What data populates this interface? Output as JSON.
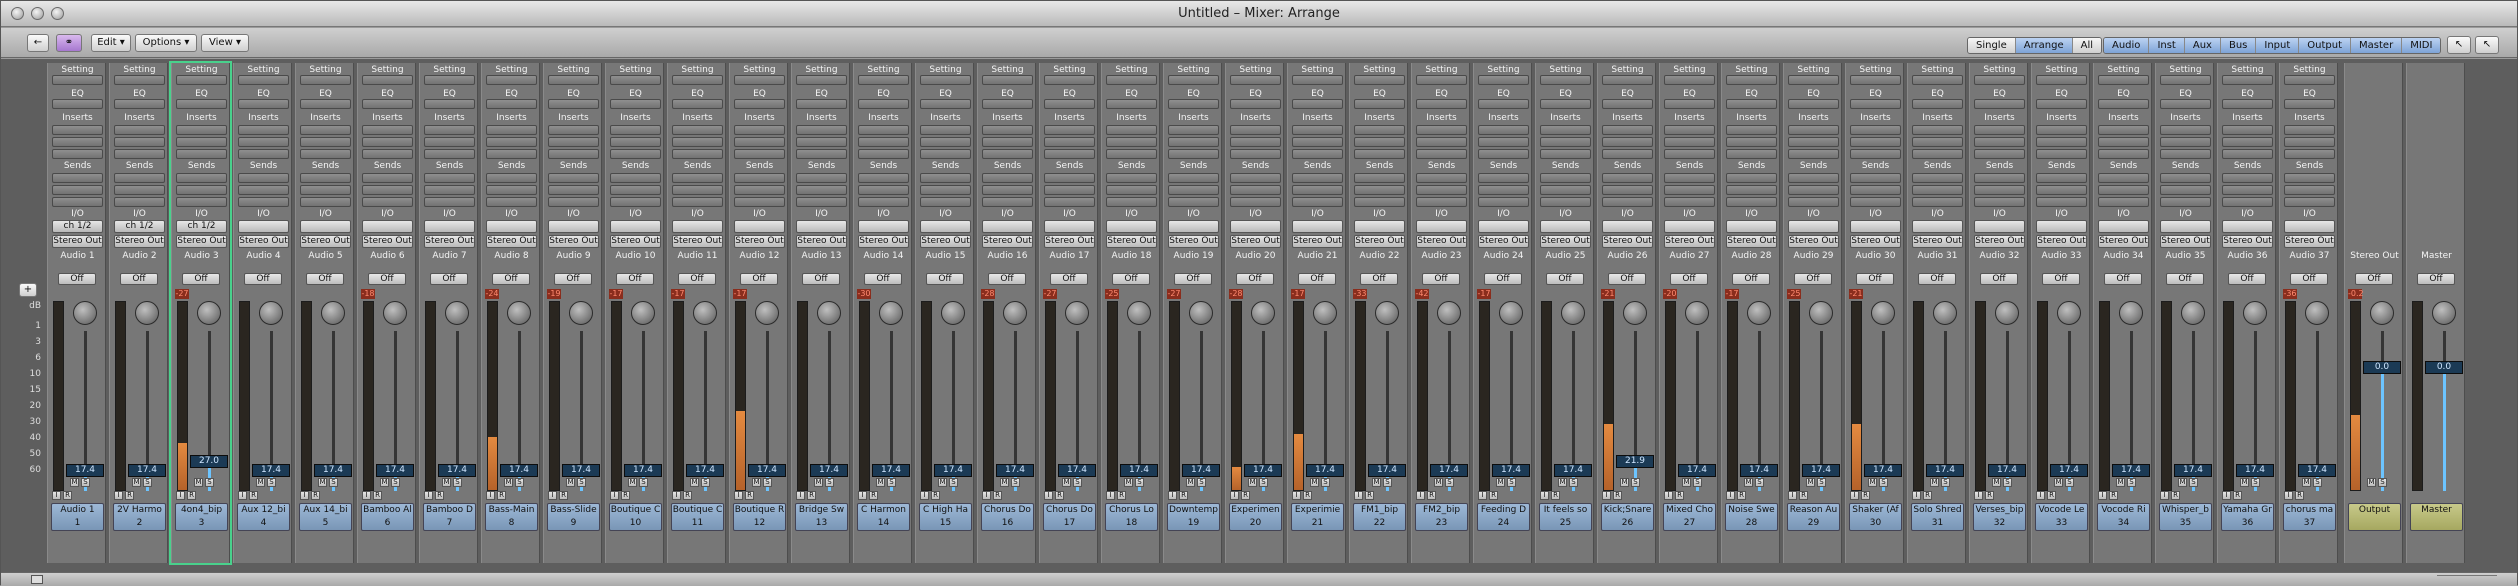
{
  "window": {
    "title": "Untitled – Mixer: Arrange"
  },
  "toolbar": {
    "link_icon": "link-icon",
    "back_icon": "arrow-left-icon",
    "menus": [
      "Edit",
      "Options",
      "View"
    ],
    "view_modes": [
      "Single",
      "Arrange",
      "All"
    ],
    "active_view_mode": "Arrange",
    "filters": [
      "Audio",
      "Inst",
      "Aux",
      "Bus",
      "Input",
      "Output",
      "Master",
      "MIDI"
    ],
    "tool_icons": [
      "pointer-tool-icon",
      "pointer-tool-secondary-icon"
    ]
  },
  "sidebar": {
    "add_label": "+",
    "db_label": "dB",
    "scale": [
      "1",
      "3",
      "6",
      "10",
      "15",
      "20",
      "30",
      "40",
      "50",
      "60"
    ]
  },
  "strip_labels": {
    "setting": "Setting",
    "eq": "EQ",
    "inserts": "Inserts",
    "sends": "Sends",
    "io": "I/O",
    "output": "Stereo Out",
    "automation": "Off",
    "mute": "M",
    "solo": "S",
    "record": "R",
    "input_monitor": "I"
  },
  "channels": [
    {
      "io": "ch 1/2",
      "route": "Audio 1",
      "peak": "",
      "vol": "17.4",
      "name": "Audio 1",
      "num": "1",
      "level": 0
    },
    {
      "io": "ch 1/2",
      "route": "Audio 2",
      "peak": "",
      "vol": "17.4",
      "name": "2V Harmo",
      "num": "2",
      "level": 0
    },
    {
      "io": "ch 1/2",
      "route": "Audio 3",
      "peak": "-27",
      "vol": "27.0",
      "name": "4on4_bip",
      "num": "3",
      "level": 0.25,
      "selected": true
    },
    {
      "io": "",
      "route": "Audio 4",
      "peak": "",
      "vol": "17.4",
      "name": "Aux 12_bi",
      "num": "4",
      "level": 0
    },
    {
      "io": "",
      "route": "Audio 5",
      "peak": "",
      "vol": "17.4",
      "name": "Aux 14_bi",
      "num": "5",
      "level": 0
    },
    {
      "io": "",
      "route": "Audio 6",
      "peak": "-18",
      "vol": "17.4",
      "name": "Bamboo Al",
      "num": "6",
      "level": 0
    },
    {
      "io": "",
      "route": "Audio 7",
      "peak": "",
      "vol": "17.4",
      "name": "Bamboo D",
      "num": "7",
      "level": 0
    },
    {
      "io": "",
      "route": "Audio 8",
      "peak": "-24",
      "vol": "17.4",
      "name": "Bass-Main",
      "num": "8",
      "level": 0.28
    },
    {
      "io": "",
      "route": "Audio 9",
      "peak": "-19",
      "vol": "17.4",
      "name": "Bass-Slide",
      "num": "9",
      "level": 0
    },
    {
      "io": "",
      "route": "Audio 10",
      "peak": "-17",
      "vol": "17.4",
      "name": "Boutique C",
      "num": "10",
      "level": 0
    },
    {
      "io": "",
      "route": "Audio 11",
      "peak": "-17",
      "vol": "17.4",
      "name": "Boutique C",
      "num": "11",
      "level": 0
    },
    {
      "io": "",
      "route": "Audio 12",
      "peak": "-17",
      "vol": "17.4",
      "name": "Boutique R",
      "num": "12",
      "level": 0.42
    },
    {
      "io": "",
      "route": "Audio 13",
      "peak": "",
      "vol": "17.4",
      "name": "Bridge Sw",
      "num": "13",
      "level": 0
    },
    {
      "io": "",
      "route": "Audio 14",
      "peak": "-30",
      "vol": "17.4",
      "name": "C Harmon",
      "num": "14",
      "level": 0
    },
    {
      "io": "",
      "route": "Audio 15",
      "peak": "",
      "vol": "17.4",
      "name": "C High Ha",
      "num": "15",
      "level": 0
    },
    {
      "io": "",
      "route": "Audio 16",
      "peak": "-28",
      "vol": "17.4",
      "name": "Chorus Do",
      "num": "16",
      "level": 0
    },
    {
      "io": "",
      "route": "Audio 17",
      "peak": "-27",
      "vol": "17.4",
      "name": "Chorus Do",
      "num": "17",
      "level": 0
    },
    {
      "io": "",
      "route": "Audio 18",
      "peak": "-25",
      "vol": "17.4",
      "name": "Chorus Lo",
      "num": "18",
      "level": 0
    },
    {
      "io": "",
      "route": "Audio 19",
      "peak": "-27",
      "vol": "17.4",
      "name": "Downtemp",
      "num": "19",
      "level": 0
    },
    {
      "io": "",
      "route": "Audio 20",
      "peak": "-28",
      "vol": "17.4",
      "name": "Experimen",
      "num": "20",
      "level": 0.12
    },
    {
      "io": "",
      "route": "Audio 21",
      "peak": "-17",
      "vol": "17.4",
      "name": "Experimie",
      "num": "21",
      "level": 0.3
    },
    {
      "io": "",
      "route": "Audio 22",
      "peak": "-33",
      "vol": "17.4",
      "name": "FM1_bip",
      "num": "22",
      "level": 0
    },
    {
      "io": "",
      "route": "Audio 23",
      "peak": "-42",
      "vol": "17.4",
      "name": "FM2_bip",
      "num": "23",
      "level": 0
    },
    {
      "io": "",
      "route": "Audio 24",
      "peak": "-17",
      "vol": "17.4",
      "name": "Feeding D",
      "num": "24",
      "level": 0
    },
    {
      "io": "",
      "route": "Audio 25",
      "peak": "",
      "vol": "17.4",
      "name": "It feels so",
      "num": "25",
      "level": 0
    },
    {
      "io": "",
      "route": "Audio 26",
      "peak": "-21",
      "vol": "21.9",
      "name": "Kick;Snare",
      "num": "26",
      "level": 0.35
    },
    {
      "io": "",
      "route": "Audio 27",
      "peak": "-20",
      "vol": "17.4",
      "name": "Mixed Cho",
      "num": "27",
      "level": 0
    },
    {
      "io": "",
      "route": "Audio 28",
      "peak": "-17",
      "vol": "17.4",
      "name": "Noise Swe",
      "num": "28",
      "level": 0
    },
    {
      "io": "",
      "route": "Audio 29",
      "peak": "-25",
      "vol": "17.4",
      "name": "Reason Au",
      "num": "29",
      "level": 0
    },
    {
      "io": "",
      "route": "Audio 30",
      "peak": "-21",
      "vol": "17.4",
      "name": "Shaker (Af",
      "num": "30",
      "level": 0.35
    },
    {
      "io": "",
      "route": "Audio 31",
      "peak": "",
      "vol": "17.4",
      "name": "Solo Shred",
      "num": "31",
      "level": 0
    },
    {
      "io": "",
      "route": "Audio 32",
      "peak": "",
      "vol": "17.4",
      "name": "Verses_bip",
      "num": "32",
      "level": 0
    },
    {
      "io": "",
      "route": "Audio 33",
      "peak": "",
      "vol": "17.4",
      "name": "Vocode Le",
      "num": "33",
      "level": 0
    },
    {
      "io": "",
      "route": "Audio 34",
      "peak": "",
      "vol": "17.4",
      "name": "Vocode Ri",
      "num": "34",
      "level": 0
    },
    {
      "io": "",
      "route": "Audio 35",
      "peak": "",
      "vol": "17.4",
      "name": "Whisper_b",
      "num": "35",
      "level": 0
    },
    {
      "io": "",
      "route": "Audio 36",
      "peak": "",
      "vol": "17.4",
      "name": "Yamaha Gr",
      "num": "36",
      "level": 0
    },
    {
      "io": "",
      "route": "Audio 37",
      "peak": "-36",
      "vol": "17.4",
      "name": "chorus ma",
      "num": "37",
      "level": 0
    }
  ],
  "output_strip": {
    "route": "Stereo Out",
    "peak": "-0.2",
    "vol": "0.0",
    "name": "Output",
    "bounce_label": "Bnce",
    "level": 0.4
  },
  "master_strip": {
    "route": "Master",
    "vol": "0.0",
    "name": "Master"
  },
  "footer": {
    "grip_icon": "resize-grip-icon",
    "panel_icon": "panel-toggle-icon"
  }
}
